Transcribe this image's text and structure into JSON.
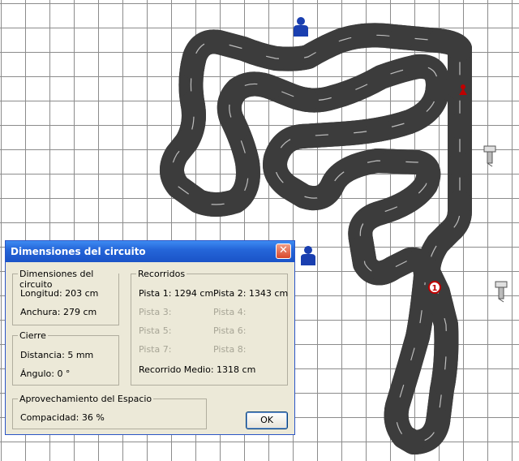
{
  "dialog": {
    "title": "Dimensiones del circuito",
    "close_glyph": "✕",
    "dimensiones": {
      "title": "Dimensiones del circuito",
      "longitud": "Longitud: 203 cm",
      "anchura": "Anchura: 279 cm"
    },
    "cierre": {
      "title": "Cierre",
      "distancia": "Distancia: 5 mm",
      "angulo": "Ángulo: 0 °"
    },
    "aprovechamiento": {
      "title": "Aprovechamiento del Espacio",
      "compacidad": "Compacidad: 36 %"
    },
    "recorridos": {
      "title": "Recorridos",
      "pistas": [
        {
          "label": "Pista 1: 1294 cm",
          "enabled": true
        },
        {
          "label": "Pista 2: 1343 cm",
          "enabled": true
        },
        {
          "label": "Pista 3:",
          "enabled": false
        },
        {
          "label": "Pista 4:",
          "enabled": false
        },
        {
          "label": "Pista 5:",
          "enabled": false
        },
        {
          "label": "Pista 6:",
          "enabled": false
        },
        {
          "label": "Pista 7:",
          "enabled": false
        },
        {
          "label": "Pista 8:",
          "enabled": false
        }
      ],
      "medio": "Recorrido Medio: 1318 cm"
    },
    "ok_label": "OK"
  },
  "markers": {
    "start_number": "1",
    "icons": [
      "person-icon",
      "person-icon",
      "control-tower-icon",
      "control-tower-icon",
      "warning-marker-icon",
      "start-marker-icon"
    ]
  },
  "colors": {
    "track": "#3c3c3c",
    "grid": "#8c8c8c",
    "title_bar": "#2566d9",
    "dialog_bg": "#ece9d8",
    "person": "#1a3fb0",
    "start_marker": "#c00000"
  }
}
